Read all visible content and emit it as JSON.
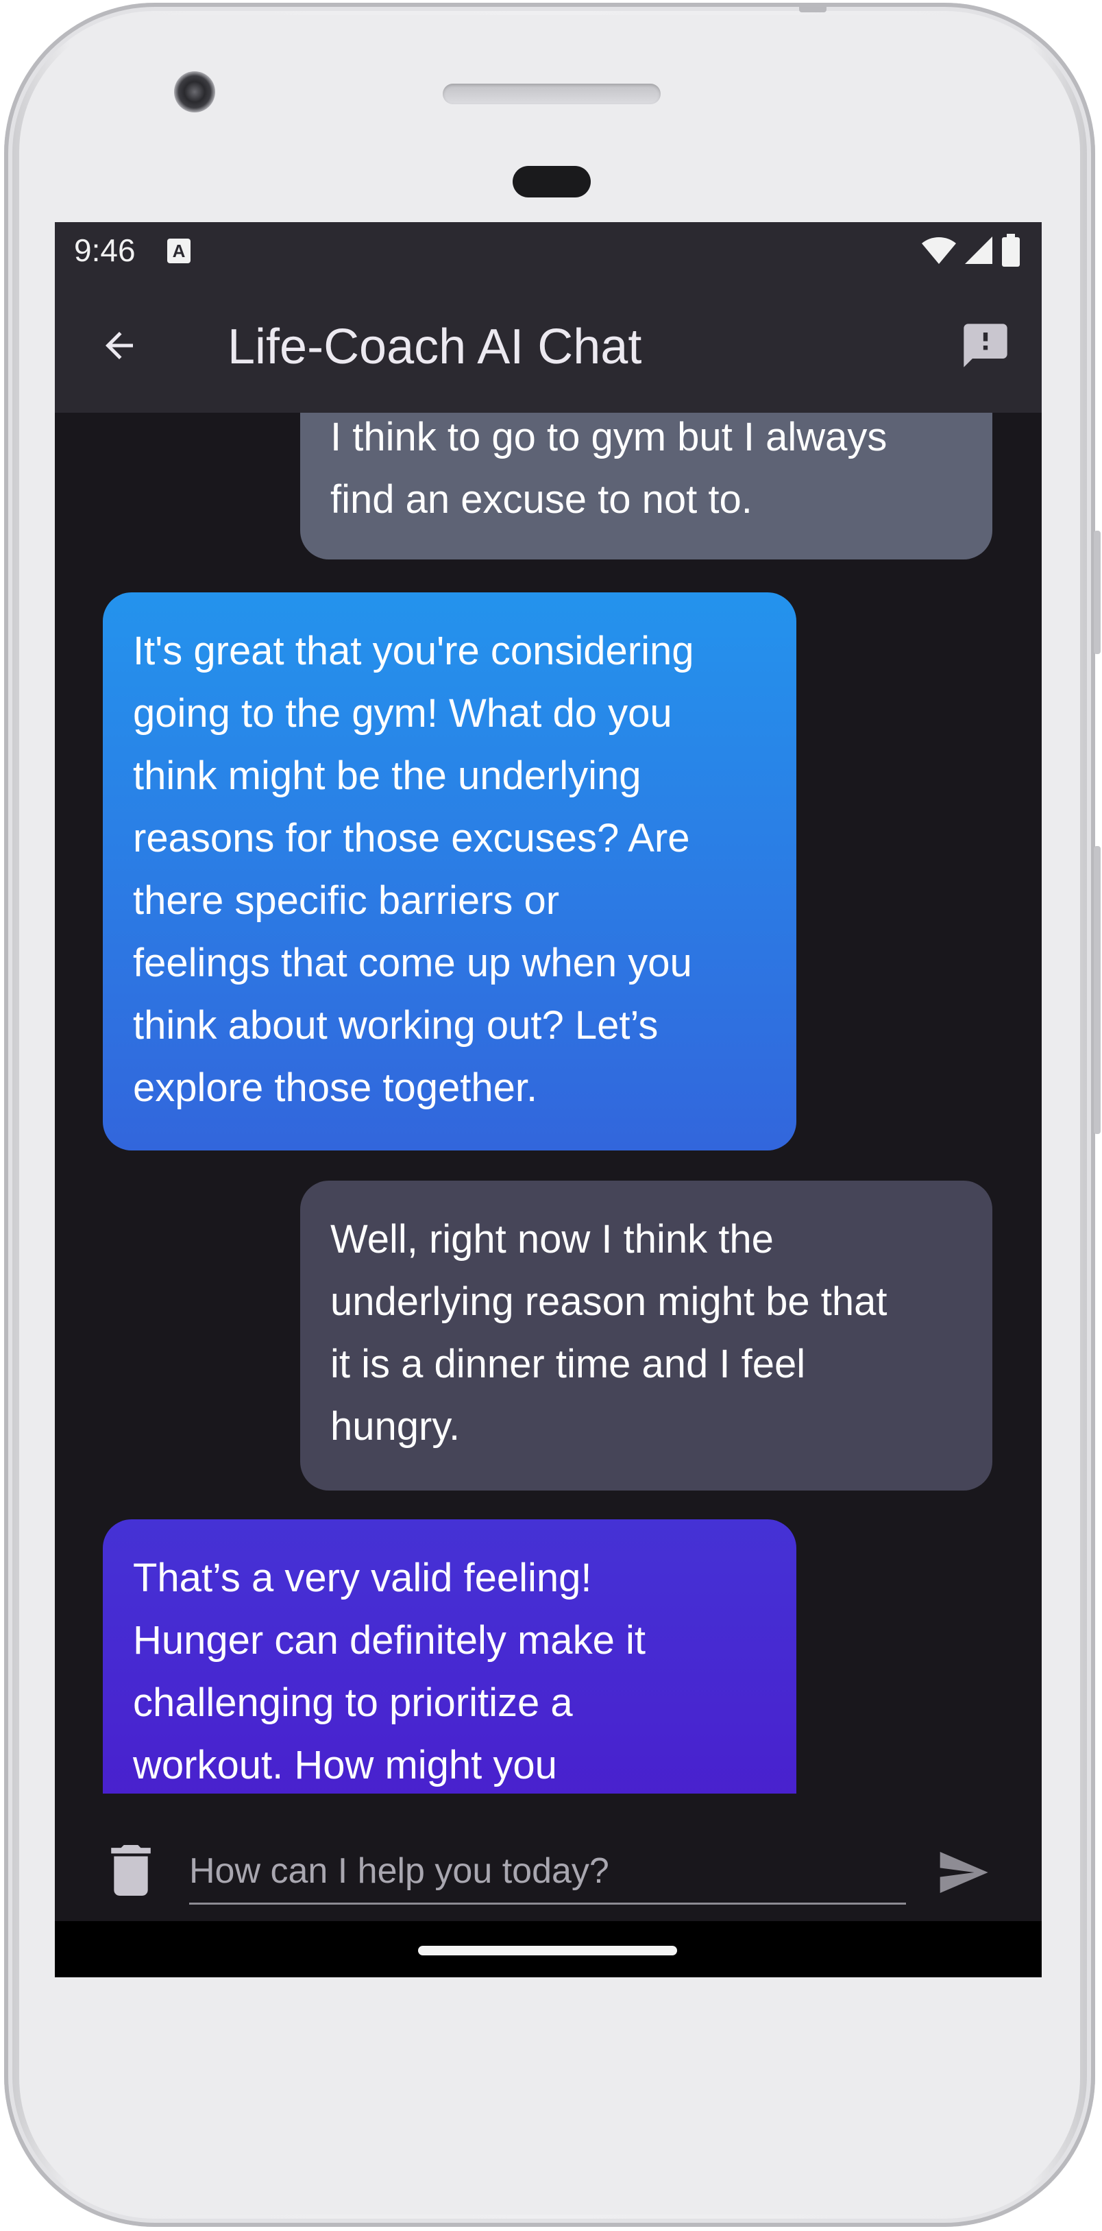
{
  "status_bar": {
    "time": "9:46",
    "notification_icon": "A",
    "icons": [
      "wifi-icon",
      "signal-icon",
      "battery-icon"
    ]
  },
  "app_bar": {
    "title": "Life-Coach AI Chat",
    "back_icon": "arrow-back-icon",
    "feedback_icon": "feedback-icon"
  },
  "messages": [
    {
      "role": "user",
      "text": "I think to go to gym but I always\nfind an excuse to not to."
    },
    {
      "role": "assistant",
      "text": "It's great that you're considering\ngoing to the gym! What do you\nthink might be the underlying\nreasons for those excuses? Are\nthere specific barriers or\nfeelings that come up when you\nthink about working out? Let’s\nexplore those together."
    },
    {
      "role": "user",
      "text": "Well, right now I think the\nunderlying reason might be that\nit is a dinner time and I feel\nhungry."
    },
    {
      "role": "assistant",
      "text": "That’s a very valid feeling!\nHunger can definitely make it\nchallenging to prioritize a\nworkout. How might you"
    }
  ],
  "input": {
    "placeholder": "How can I help you today?",
    "value": "",
    "clear_icon": "trash-icon",
    "send_icon": "send-icon"
  },
  "colors": {
    "app_bar": "#2b2930",
    "chat_background": "#19171c",
    "user_bubble_1": "#5e6375",
    "user_bubble_2": "#464558",
    "assistant_bubble_1": "#2493ed",
    "assistant_bubble_2": "#4532d5"
  }
}
